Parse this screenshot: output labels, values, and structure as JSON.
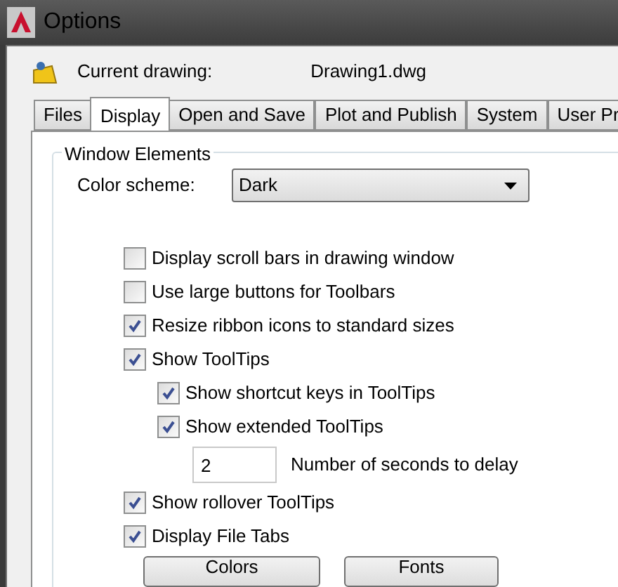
{
  "window": {
    "title": "Options"
  },
  "current_drawing": {
    "label": "Current drawing:",
    "value": "Drawing1.dwg"
  },
  "tabs": [
    {
      "label": "Files",
      "selected": false
    },
    {
      "label": "Display",
      "selected": true
    },
    {
      "label": "Open and Save",
      "selected": false
    },
    {
      "label": "Plot and Publish",
      "selected": false
    },
    {
      "label": "System",
      "selected": false
    },
    {
      "label": "User Pr",
      "selected": false
    }
  ],
  "group": {
    "title": "Window Elements",
    "color_scheme": {
      "label": "Color scheme:",
      "value": "Dark"
    },
    "options": [
      {
        "kind": "checkbox",
        "label": "Display scroll bars in drawing window",
        "checked": false
      },
      {
        "kind": "checkbox",
        "label": "Use large buttons for Toolbars",
        "checked": false
      },
      {
        "kind": "checkbox",
        "label": "Resize ribbon icons to standard sizes",
        "checked": true
      },
      {
        "kind": "checkbox",
        "label": "Show ToolTips",
        "checked": true,
        "children": [
          {
            "kind": "checkbox",
            "label": "Show shortcut keys in ToolTips",
            "checked": true
          },
          {
            "kind": "checkbox",
            "label": "Show extended ToolTips",
            "checked": true
          },
          {
            "kind": "number",
            "value": "2",
            "caption": "Number of seconds to delay"
          }
        ]
      },
      {
        "kind": "checkbox",
        "label": "Show rollover ToolTips",
        "checked": true
      },
      {
        "kind": "checkbox",
        "label": "Display File Tabs",
        "checked": true
      }
    ],
    "buttons": [
      "Colors",
      "Fonts"
    ]
  }
}
